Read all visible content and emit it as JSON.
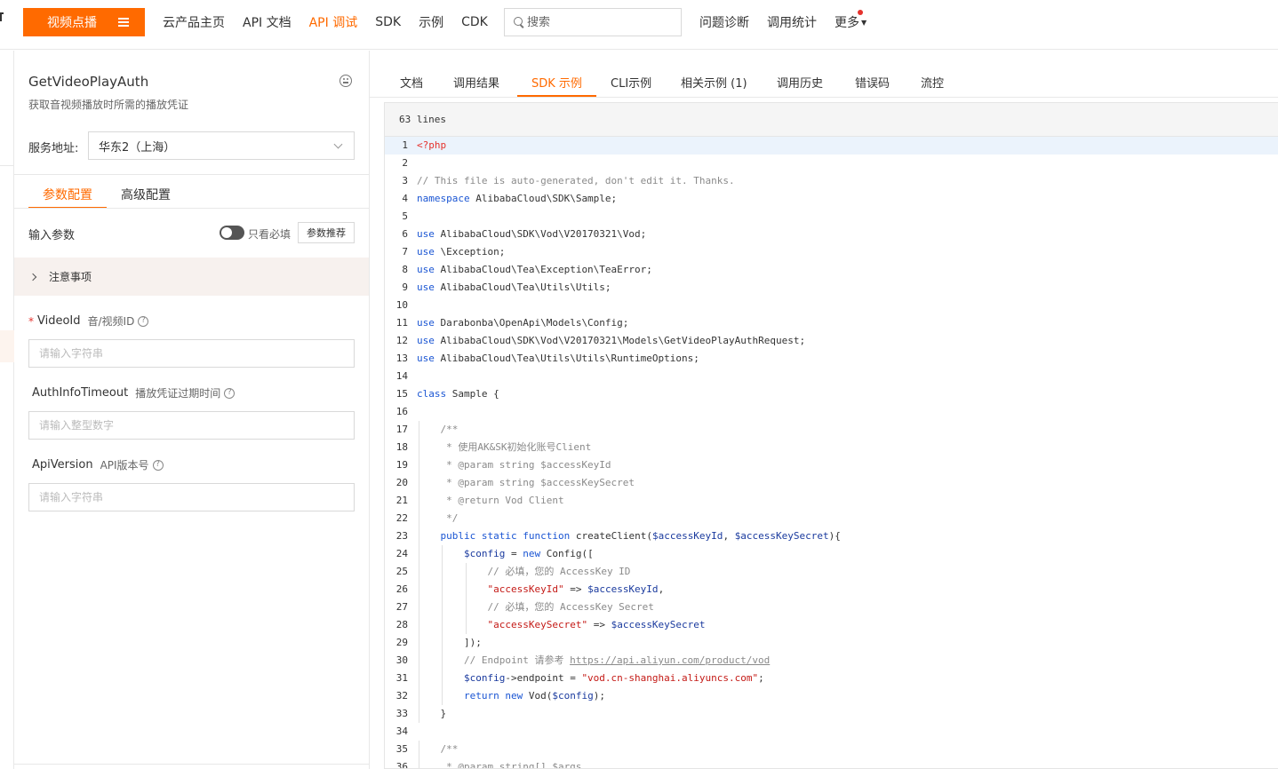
{
  "topnav": {
    "brand_label": "视频点播",
    "links": [
      "云产品主页",
      "API 文档",
      "API 调试",
      "SDK",
      "示例",
      "CDK"
    ],
    "active_link": "API 调试",
    "search_placeholder": "搜索",
    "right_links": [
      "问题诊断",
      "调用统计"
    ],
    "more_label": "更多",
    "accent_color": "#ff6a00"
  },
  "left": {
    "api_name": "GetVideoPlayAuth",
    "api_desc": "获取音视频播放时所需的播放凭证",
    "endpoint_label": "服务地址:",
    "endpoint_value": "华东2（上海）",
    "tabs": [
      "参数配置",
      "高级配置"
    ],
    "input_params_label": "输入参数",
    "only_required_label": "只看必填",
    "recommend_label": "参数推荐",
    "notice_label": "注意事项",
    "fields": [
      {
        "required": "*",
        "name": "VideoId",
        "desc": "音/视频ID",
        "placeholder": "请输入字符串"
      },
      {
        "required": "",
        "name": "AuthInfoTimeout",
        "desc": "播放凭证过期时间",
        "placeholder": "请输入整型数字"
      },
      {
        "required": "",
        "name": "ApiVersion",
        "desc": "API版本号",
        "placeholder": "请输入字符串"
      }
    ]
  },
  "main": {
    "tabs": [
      "文档",
      "调用结果",
      "SDK 示例",
      "CLI示例",
      "相关示例 (1)",
      "调用历史",
      "错误码",
      "流控"
    ],
    "active_tab": "SDK 示例",
    "lines_label": "63 lines"
  },
  "code_lines": [
    {
      "n": "1",
      "t": "<?php"
    },
    {
      "n": "2",
      "t": ""
    },
    {
      "n": "3",
      "t": "// This file is auto-generated, don't edit it. Thanks."
    },
    {
      "n": "4",
      "t": "namespace AlibabaCloud\\SDK\\Sample;"
    },
    {
      "n": "5",
      "t": ""
    },
    {
      "n": "6",
      "t": "use AlibabaCloud\\SDK\\Vod\\V20170321\\Vod;"
    },
    {
      "n": "7",
      "t": "use \\Exception;"
    },
    {
      "n": "8",
      "t": "use AlibabaCloud\\Tea\\Exception\\TeaError;"
    },
    {
      "n": "9",
      "t": "use AlibabaCloud\\Tea\\Utils\\Utils;"
    },
    {
      "n": "10",
      "t": ""
    },
    {
      "n": "11",
      "t": "use Darabonba\\OpenApi\\Models\\Config;"
    },
    {
      "n": "12",
      "t": "use AlibabaCloud\\SDK\\Vod\\V20170321\\Models\\GetVideoPlayAuthRequest;"
    },
    {
      "n": "13",
      "t": "use AlibabaCloud\\Tea\\Utils\\Utils\\RuntimeOptions;"
    },
    {
      "n": "14",
      "t": ""
    },
    {
      "n": "15",
      "t": "class Sample {"
    },
    {
      "n": "16",
      "t": ""
    },
    {
      "n": "17",
      "t": "    /**"
    },
    {
      "n": "18",
      "t": "     * 使用AK&SK初始化账号Client"
    },
    {
      "n": "19",
      "t": "     * @param string $accessKeyId"
    },
    {
      "n": "20",
      "t": "     * @param string $accessKeySecret"
    },
    {
      "n": "21",
      "t": "     * @return Vod Client"
    },
    {
      "n": "22",
      "t": "     */"
    },
    {
      "n": "23",
      "t": "    public static function createClient($accessKeyId, $accessKeySecret){"
    },
    {
      "n": "24",
      "t": "        $config = new Config(["
    },
    {
      "n": "25",
      "t": "            // 必填，您的 AccessKey ID"
    },
    {
      "n": "26",
      "t": "            \"accessKeyId\" => $accessKeyId,"
    },
    {
      "n": "27",
      "t": "            // 必填，您的 AccessKey Secret"
    },
    {
      "n": "28",
      "t": "            \"accessKeySecret\" => $accessKeySecret"
    },
    {
      "n": "29",
      "t": "        ]);"
    },
    {
      "n": "30",
      "t": "        // Endpoint 请参考 https://api.aliyun.com/product/vod"
    },
    {
      "n": "31",
      "t": "        $config->endpoint = \"vod.cn-shanghai.aliyuncs.com\";"
    },
    {
      "n": "32",
      "t": "        return new Vod($config);"
    },
    {
      "n": "33",
      "t": "    }"
    },
    {
      "n": "34",
      "t": ""
    },
    {
      "n": "35",
      "t": "    /**"
    },
    {
      "n": "36",
      "t": "     * @param string[] $args"
    }
  ]
}
